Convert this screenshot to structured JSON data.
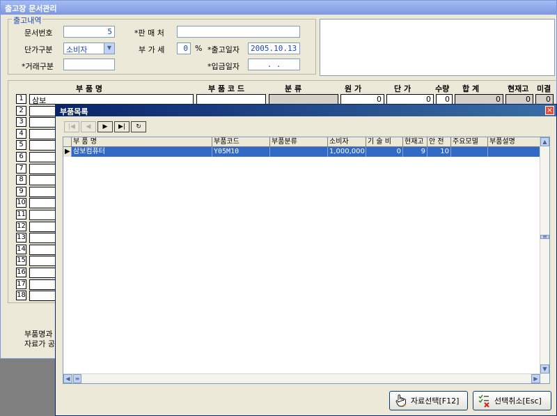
{
  "window": {
    "title": "출고장 문서관리"
  },
  "form": {
    "group_label": "출고내역",
    "doc_no_label": "문서번호",
    "doc_no": "5",
    "price_type_label": "단가구분",
    "price_type": "소비자",
    "trade_type_label": "*거래구분",
    "trade_type": "",
    "seller_label": "*판 매 처",
    "seller": "",
    "vat_label": "부 가 세",
    "vat": "0",
    "vat_unit": "%",
    "ship_date_label": "*출고일자",
    "ship_date": "2005.10.13",
    "deposit_date_label": "*입금일자",
    "deposit_date": ". ."
  },
  "table": {
    "headers": [
      "부 품 명",
      "부 품 코 드",
      "분 류",
      "원 가",
      "단 가",
      "수량",
      "합 계",
      "현재고",
      "미결"
    ],
    "row_numbers": [
      "1",
      "2",
      "3",
      "4",
      "5",
      "6",
      "7",
      "8",
      "9",
      "10",
      "11",
      "12",
      "13",
      "14",
      "15",
      "16",
      "17",
      "18"
    ],
    "row1": {
      "name": "삼보",
      "cost": "0",
      "price": "0",
      "qty": "0",
      "total": "0",
      "stock": "0",
      "pending": "0"
    },
    "footer_line1": "부품명과",
    "footer_line2": "자료가 공"
  },
  "dialog": {
    "title": "부품목록",
    "close": "×",
    "columns": [
      "부 품 명",
      "부품코드",
      "부품분류",
      "소비자",
      "기 술 비",
      "현재고",
      "안 전",
      "주요모델",
      "부품설명"
    ],
    "rows": [
      {
        "name": "삼보컴퓨터",
        "code": "Y05M10",
        "category": "",
        "consumer": "1,000,000",
        "tech": "0",
        "stock": "9",
        "safety": "10",
        "model": "",
        "desc": ""
      }
    ],
    "select_button": "자료선택[F12]",
    "cancel_button": "선택취소[Esc]"
  }
}
